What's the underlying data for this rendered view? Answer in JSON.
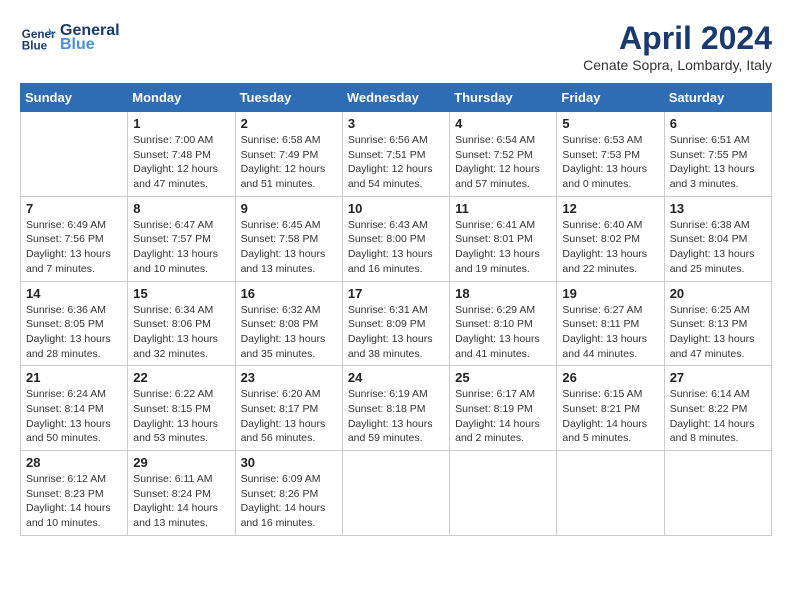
{
  "header": {
    "logo_line1": "General",
    "logo_line2": "Blue",
    "title": "April 2024",
    "subtitle": "Cenate Sopra, Lombardy, Italy"
  },
  "weekdays": [
    "Sunday",
    "Monday",
    "Tuesday",
    "Wednesday",
    "Thursday",
    "Friday",
    "Saturday"
  ],
  "weeks": [
    [
      {
        "day": "",
        "info": ""
      },
      {
        "day": "1",
        "info": "Sunrise: 7:00 AM\nSunset: 7:48 PM\nDaylight: 12 hours\nand 47 minutes."
      },
      {
        "day": "2",
        "info": "Sunrise: 6:58 AM\nSunset: 7:49 PM\nDaylight: 12 hours\nand 51 minutes."
      },
      {
        "day": "3",
        "info": "Sunrise: 6:56 AM\nSunset: 7:51 PM\nDaylight: 12 hours\nand 54 minutes."
      },
      {
        "day": "4",
        "info": "Sunrise: 6:54 AM\nSunset: 7:52 PM\nDaylight: 12 hours\nand 57 minutes."
      },
      {
        "day": "5",
        "info": "Sunrise: 6:53 AM\nSunset: 7:53 PM\nDaylight: 13 hours\nand 0 minutes."
      },
      {
        "day": "6",
        "info": "Sunrise: 6:51 AM\nSunset: 7:55 PM\nDaylight: 13 hours\nand 3 minutes."
      }
    ],
    [
      {
        "day": "7",
        "info": "Sunrise: 6:49 AM\nSunset: 7:56 PM\nDaylight: 13 hours\nand 7 minutes."
      },
      {
        "day": "8",
        "info": "Sunrise: 6:47 AM\nSunset: 7:57 PM\nDaylight: 13 hours\nand 10 minutes."
      },
      {
        "day": "9",
        "info": "Sunrise: 6:45 AM\nSunset: 7:58 PM\nDaylight: 13 hours\nand 13 minutes."
      },
      {
        "day": "10",
        "info": "Sunrise: 6:43 AM\nSunset: 8:00 PM\nDaylight: 13 hours\nand 16 minutes."
      },
      {
        "day": "11",
        "info": "Sunrise: 6:41 AM\nSunset: 8:01 PM\nDaylight: 13 hours\nand 19 minutes."
      },
      {
        "day": "12",
        "info": "Sunrise: 6:40 AM\nSunset: 8:02 PM\nDaylight: 13 hours\nand 22 minutes."
      },
      {
        "day": "13",
        "info": "Sunrise: 6:38 AM\nSunset: 8:04 PM\nDaylight: 13 hours\nand 25 minutes."
      }
    ],
    [
      {
        "day": "14",
        "info": "Sunrise: 6:36 AM\nSunset: 8:05 PM\nDaylight: 13 hours\nand 28 minutes."
      },
      {
        "day": "15",
        "info": "Sunrise: 6:34 AM\nSunset: 8:06 PM\nDaylight: 13 hours\nand 32 minutes."
      },
      {
        "day": "16",
        "info": "Sunrise: 6:32 AM\nSunset: 8:08 PM\nDaylight: 13 hours\nand 35 minutes."
      },
      {
        "day": "17",
        "info": "Sunrise: 6:31 AM\nSunset: 8:09 PM\nDaylight: 13 hours\nand 38 minutes."
      },
      {
        "day": "18",
        "info": "Sunrise: 6:29 AM\nSunset: 8:10 PM\nDaylight: 13 hours\nand 41 minutes."
      },
      {
        "day": "19",
        "info": "Sunrise: 6:27 AM\nSunset: 8:11 PM\nDaylight: 13 hours\nand 44 minutes."
      },
      {
        "day": "20",
        "info": "Sunrise: 6:25 AM\nSunset: 8:13 PM\nDaylight: 13 hours\nand 47 minutes."
      }
    ],
    [
      {
        "day": "21",
        "info": "Sunrise: 6:24 AM\nSunset: 8:14 PM\nDaylight: 13 hours\nand 50 minutes."
      },
      {
        "day": "22",
        "info": "Sunrise: 6:22 AM\nSunset: 8:15 PM\nDaylight: 13 hours\nand 53 minutes."
      },
      {
        "day": "23",
        "info": "Sunrise: 6:20 AM\nSunset: 8:17 PM\nDaylight: 13 hours\nand 56 minutes."
      },
      {
        "day": "24",
        "info": "Sunrise: 6:19 AM\nSunset: 8:18 PM\nDaylight: 13 hours\nand 59 minutes."
      },
      {
        "day": "25",
        "info": "Sunrise: 6:17 AM\nSunset: 8:19 PM\nDaylight: 14 hours\nand 2 minutes."
      },
      {
        "day": "26",
        "info": "Sunrise: 6:15 AM\nSunset: 8:21 PM\nDaylight: 14 hours\nand 5 minutes."
      },
      {
        "day": "27",
        "info": "Sunrise: 6:14 AM\nSunset: 8:22 PM\nDaylight: 14 hours\nand 8 minutes."
      }
    ],
    [
      {
        "day": "28",
        "info": "Sunrise: 6:12 AM\nSunset: 8:23 PM\nDaylight: 14 hours\nand 10 minutes."
      },
      {
        "day": "29",
        "info": "Sunrise: 6:11 AM\nSunset: 8:24 PM\nDaylight: 14 hours\nand 13 minutes."
      },
      {
        "day": "30",
        "info": "Sunrise: 6:09 AM\nSunset: 8:26 PM\nDaylight: 14 hours\nand 16 minutes."
      },
      {
        "day": "",
        "info": ""
      },
      {
        "day": "",
        "info": ""
      },
      {
        "day": "",
        "info": ""
      },
      {
        "day": "",
        "info": ""
      }
    ]
  ]
}
